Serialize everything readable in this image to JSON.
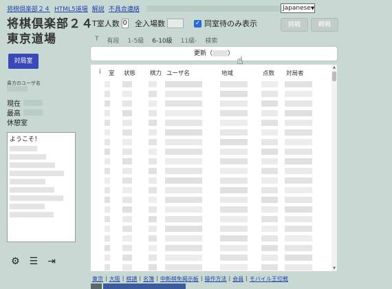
{
  "top_links": {
    "site_link": "将棋倶楽部２４",
    "html5_link": "HTML5道場",
    "manual_link": "解説",
    "notice_link": "不具合連絡"
  },
  "language_select": {
    "selected": "Japanese"
  },
  "title": {
    "line1": "将棋倶楽部２４",
    "line2": "東京道場"
  },
  "room_count": {
    "label": "T室人数",
    "value": "0"
  },
  "total_count": {
    "label": "全入場数"
  },
  "same_room_checkbox": {
    "label": "同室待のみ表示",
    "checked": true
  },
  "buttons": {
    "watch": "挑戦",
    "observe": "観戦",
    "match": "対局室"
  },
  "tabs": [
    "T",
    "有段",
    "1-5級",
    "6-10級",
    "11級-",
    "検索"
  ],
  "active_tab": "6-10級",
  "refresh": {
    "prefix": "更新（",
    "suffix": "）"
  },
  "table": {
    "headers": [
      "i",
      "室",
      "状態",
      "棋力",
      "ユーザ名",
      "地域",
      "点数",
      "対局者"
    ]
  },
  "sidebar": {
    "user_label": "貴方のユーザ名",
    "current_label": "現在",
    "max_label": "最高",
    "rest_label": "休憩室"
  },
  "chat": {
    "welcome": "ようこそ！"
  },
  "icons": [
    "gear-icon",
    "list-icon",
    "logout-icon"
  ],
  "footer_links": [
    "東京",
    "大阪",
    "棋譜",
    "名簿",
    "中断棋免掲示板",
    "操作方法",
    "会員",
    "モバイル王位戦"
  ]
}
